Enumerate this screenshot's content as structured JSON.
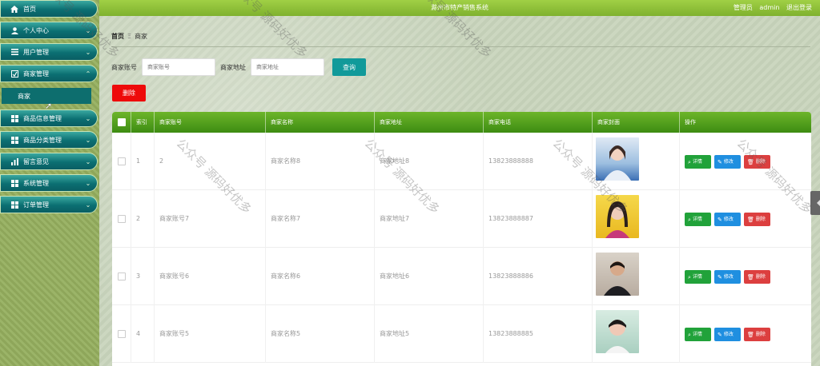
{
  "header": {
    "title": "滁州市特产销售系统",
    "role": "管理员",
    "username": "admin",
    "logout": "退出登录"
  },
  "sidebar": {
    "items": [
      {
        "label": "首页",
        "icon": "home-icon"
      },
      {
        "label": "个人中心",
        "icon": "user-icon"
      },
      {
        "label": "用户管理",
        "icon": "list-icon"
      },
      {
        "label": "商家管理",
        "icon": "clipboard-icon"
      },
      {
        "label": "商品信息管理",
        "icon": "grid-icon"
      },
      {
        "label": "商品分类管理",
        "icon": "grid-icon"
      },
      {
        "label": "留言意见",
        "icon": "bar-chart-icon"
      },
      {
        "label": "系统管理",
        "icon": "grid-icon"
      },
      {
        "label": "订单管理",
        "icon": "grid-icon"
      }
    ],
    "active_sub": "商家"
  },
  "breadcrumb": {
    "home": "首页",
    "separator": "Ξ",
    "current": "商家"
  },
  "search": {
    "account_label": "商家账号",
    "account_placeholder": "商家账号",
    "address_label": "商家地址",
    "address_placeholder": "商家地址",
    "query_button": "查询"
  },
  "delete_button": "删除",
  "table": {
    "columns": [
      "索引",
      "商家账号",
      "商家名称",
      "商家地址",
      "商家电话",
      "商家封面",
      "操作"
    ],
    "rows": [
      {
        "index": "1",
        "account": "2",
        "name": "商家名称8",
        "address": "商家地址8",
        "phone": "13823888888"
      },
      {
        "index": "2",
        "account": "商家账号7",
        "name": "商家名称7",
        "address": "商家地址7",
        "phone": "13823888887"
      },
      {
        "index": "3",
        "account": "商家账号6",
        "name": "商家名称6",
        "address": "商家地址6",
        "phone": "13823888886"
      },
      {
        "index": "4",
        "account": "商家账号5",
        "name": "商家名称5",
        "address": "商家地址5",
        "phone": "13823888885"
      }
    ],
    "actions": {
      "detail": "详情",
      "edit": "修改",
      "delete": "删除"
    }
  },
  "watermark": "公众号 源码好优多",
  "colors": {
    "header": "#8fc23a",
    "menu": "#0b6f72",
    "query": "#119a9a",
    "delete": "#ee0a0a",
    "detail": "#21a23a",
    "edit": "#1f8fe0",
    "row_delete": "#dc3f3f"
  }
}
